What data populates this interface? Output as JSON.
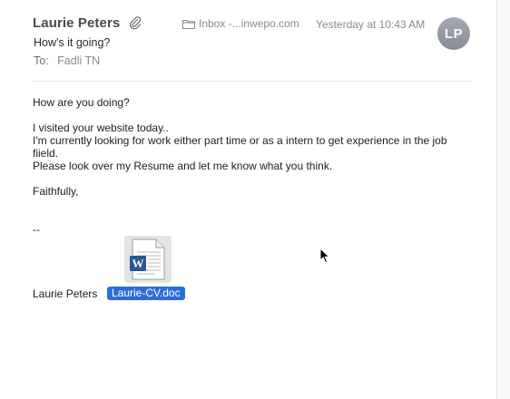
{
  "header": {
    "sender": "Laurie Peters",
    "mailbox": "Inbox -...inwepo.com",
    "date": "Yesterday at 10:43 AM",
    "avatar_initials": "LP",
    "subject": "How's it going?",
    "to_label": "To:",
    "to_value": "Fadli TN"
  },
  "icons": {
    "attachment": "paperclip-icon",
    "mailbox": "folder-icon",
    "file": "word-document-icon",
    "pointer": "mouse-cursor-icon"
  },
  "body": {
    "greeting": "How are you doing?",
    "lines": [
      "I visited your website today..",
      "I'm currently looking for work either part time or as a intern to get experience in the job fiield.",
      "Please look over my Resume and let me know what you think."
    ],
    "closing": "Faithfully,",
    "signature_dash": "--",
    "signature_name": "Laurie Peters"
  },
  "attachment": {
    "filename": "Laurie-CV.doc"
  },
  "colors": {
    "selection": "#2c6ed5",
    "avatar": "#979ba3",
    "secondary_text": "#8a8a8a",
    "word_blue": "#2b5797"
  }
}
